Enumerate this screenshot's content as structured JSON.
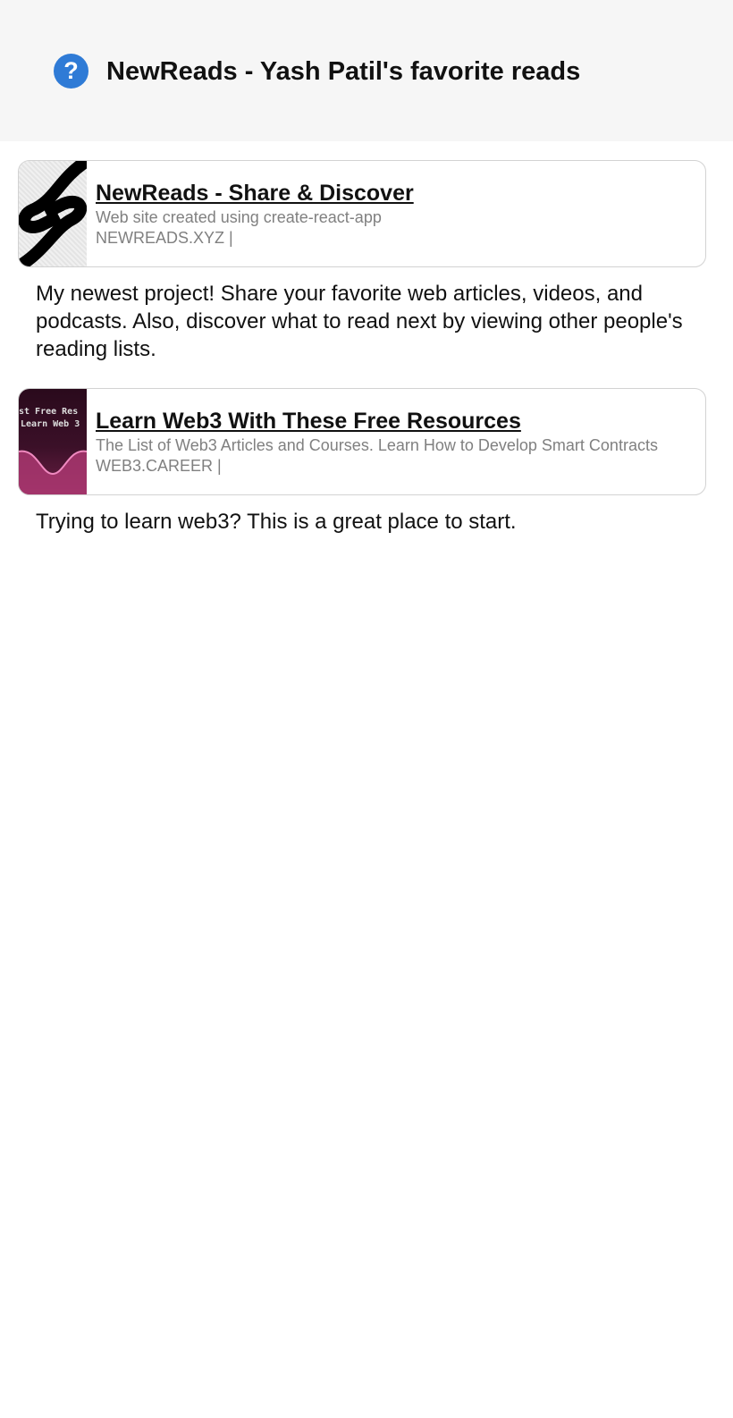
{
  "header": {
    "title": "NewReads - Yash Patil's favorite reads",
    "icon": "help-circle-icon",
    "accent": "#2f7bd6"
  },
  "items": [
    {
      "title": "NewReads - Share & Discover",
      "subtitle": "Web site created using create-react-app",
      "domain": "NEWREADS.XYZ |",
      "description": "My newest project! Share your favorite web articles, videos, and podcasts. Also, discover what to read next by viewing other people's reading lists."
    },
    {
      "title": "Learn Web3 With These Free Resources",
      "subtitle": "The List of Web3 Articles and Courses. Learn How to Develop Smart Contracts",
      "domain": "WEB3.CAREER |",
      "description": "Trying to learn web3? This is a great place to start.",
      "thumb_text": [
        "st Free Res",
        "Learn Web 3"
      ]
    }
  ]
}
